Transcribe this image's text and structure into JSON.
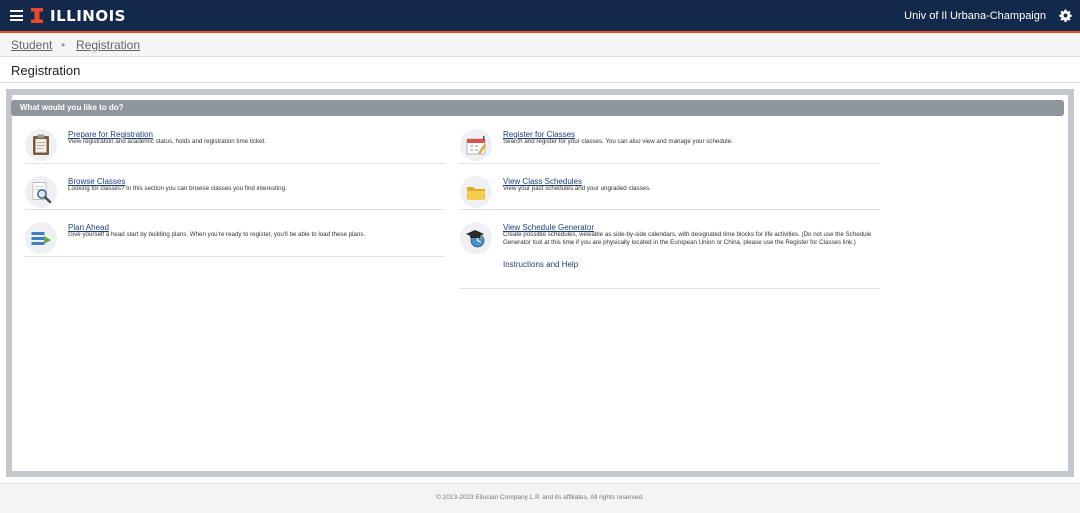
{
  "header": {
    "logo_text": "ILLINOIS",
    "institution": "Univ of Il Urbana-Champaign",
    "brand_color": "#13294b",
    "accent_color": "#e84a27"
  },
  "breadcrumb": {
    "items": [
      {
        "label": "Student"
      },
      {
        "label": "Registration"
      }
    ],
    "separator": "•"
  },
  "page": {
    "title": "Registration"
  },
  "section": {
    "header": "What would you like to do?"
  },
  "items": {
    "prepare": {
      "title": "Prepare for Registration",
      "description": "View registration and academic status, holds and registration time ticket.",
      "icon": "clipboard-icon"
    },
    "register": {
      "title": "Register for Classes",
      "description": "Search and register for your classes. You can also view and manage your schedule.",
      "icon": "calendar-pen-icon"
    },
    "browse": {
      "title": "Browse Classes",
      "description": "Looking for classes? In this section you can browse classes you find interesting.",
      "icon": "magnifier-document-icon"
    },
    "schedules": {
      "title": "View Class Schedules",
      "description": "View your past schedules and your ungraded classes.",
      "icon": "folder-icon"
    },
    "plan": {
      "title": "Plan Ahead",
      "description": "Give yourself a head start by building plans. When you're ready to register, you'll be able to load these plans.",
      "icon": "list-arrow-icon"
    },
    "generator": {
      "title": "View Schedule Generator",
      "description": "Create possible schedules, viewable as side-by-side calendars, with designated time blocks for life activities. (Do not use the Schedule Generator tool at this time if you are physically located in the European Union or China, please use the Register for Classes link.)",
      "help": "Instructions and Help",
      "icon": "mortarboard-clock-icon"
    }
  },
  "footer": {
    "copyright": "© 2013-2023 Ellucian Company L.P. and its affiliates. All rights reserved."
  }
}
